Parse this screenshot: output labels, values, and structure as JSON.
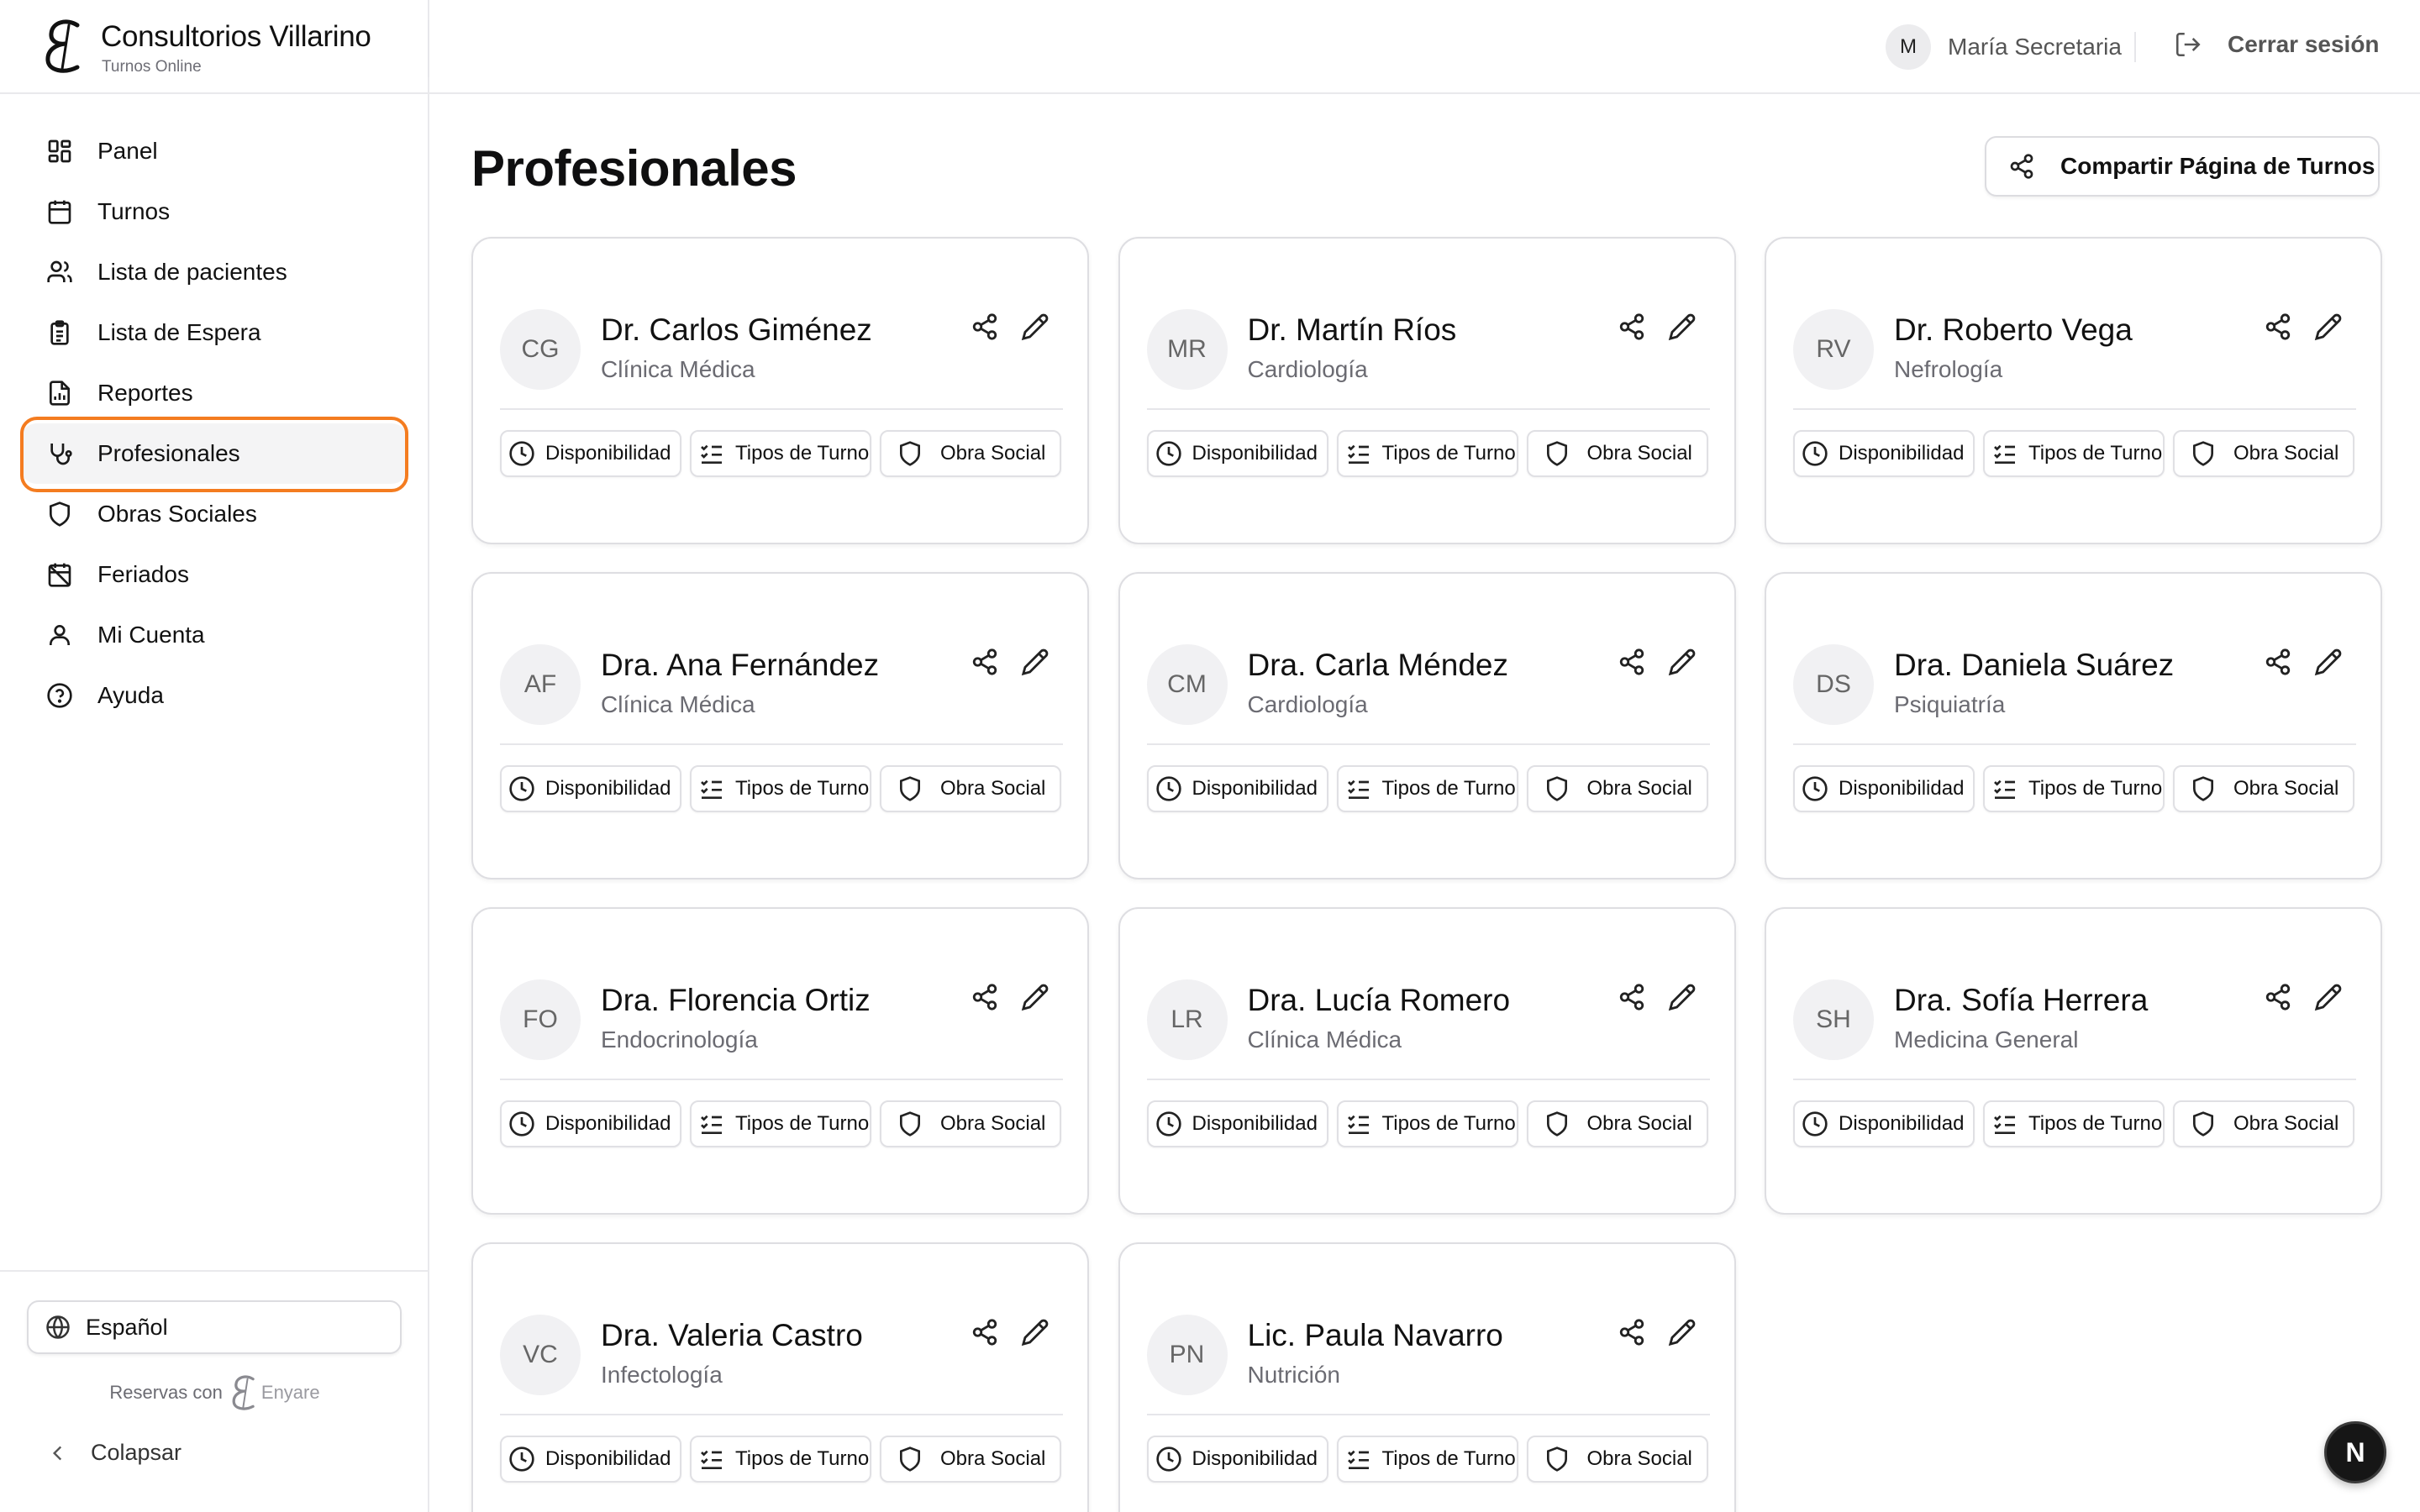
{
  "brand": {
    "name": "Consultorios Villarino",
    "subtitle": "Turnos Online"
  },
  "sidebar": {
    "items": [
      {
        "label": "Panel",
        "icon": "grid-icon"
      },
      {
        "label": "Turnos",
        "icon": "calendar-icon"
      },
      {
        "label": "Lista de pacientes",
        "icon": "users-icon"
      },
      {
        "label": "Lista de Espera",
        "icon": "clipboard-icon"
      },
      {
        "label": "Reportes",
        "icon": "report-icon"
      },
      {
        "label": "Profesionales",
        "icon": "stethoscope-icon",
        "active": true
      },
      {
        "label": "Obras Sociales",
        "icon": "shield-icon"
      },
      {
        "label": "Feriados",
        "icon": "calendar-off-icon"
      },
      {
        "label": "Mi Cuenta",
        "icon": "user-icon"
      },
      {
        "label": "Ayuda",
        "icon": "help-circle-icon"
      }
    ],
    "language": "Español",
    "powered_by_text": "Reservas con",
    "powered_by_brand": "Enyare",
    "collapse_label": "Colapsar"
  },
  "topbar": {
    "user_initial": "M",
    "user_name": "María Secretaria",
    "logout_label": "Cerrar sesión"
  },
  "main": {
    "title": "Profesionales",
    "share_button_label": "Compartir Página de Turnos",
    "action_labels": {
      "availability": "Disponibilidad",
      "appointment_types": "Tipos de Turno",
      "insurance": "Obra Social"
    },
    "professionals": [
      {
        "initials": "CG",
        "name": "Dr. Carlos Giménez",
        "specialty": "Clínica Médica"
      },
      {
        "initials": "MR",
        "name": "Dr. Martín Ríos",
        "specialty": "Cardiología"
      },
      {
        "initials": "RV",
        "name": "Dr. Roberto Vega",
        "specialty": "Nefrología"
      },
      {
        "initials": "AF",
        "name": "Dra. Ana Fernández",
        "specialty": "Clínica Médica"
      },
      {
        "initials": "CM",
        "name": "Dra. Carla Méndez",
        "specialty": "Cardiología"
      },
      {
        "initials": "DS",
        "name": "Dra. Daniela Suárez",
        "specialty": "Psiquiatría"
      },
      {
        "initials": "FO",
        "name": "Dra. Florencia Ortiz",
        "specialty": "Endocrinología"
      },
      {
        "initials": "LR",
        "name": "Dra. Lucía Romero",
        "specialty": "Clínica Médica"
      },
      {
        "initials": "SH",
        "name": "Dra. Sofía Herrera",
        "specialty": "Medicina General"
      },
      {
        "initials": "VC",
        "name": "Dra. Valeria Castro",
        "specialty": "Infectología"
      },
      {
        "initials": "PN",
        "name": "Lic. Paula Navarro",
        "specialty": "Nutrición"
      }
    ]
  },
  "fab_label": "N",
  "colors": {
    "accent_active_ring": "#f47c20",
    "border": "#dedee2",
    "muted_text": "#6b6b72"
  }
}
